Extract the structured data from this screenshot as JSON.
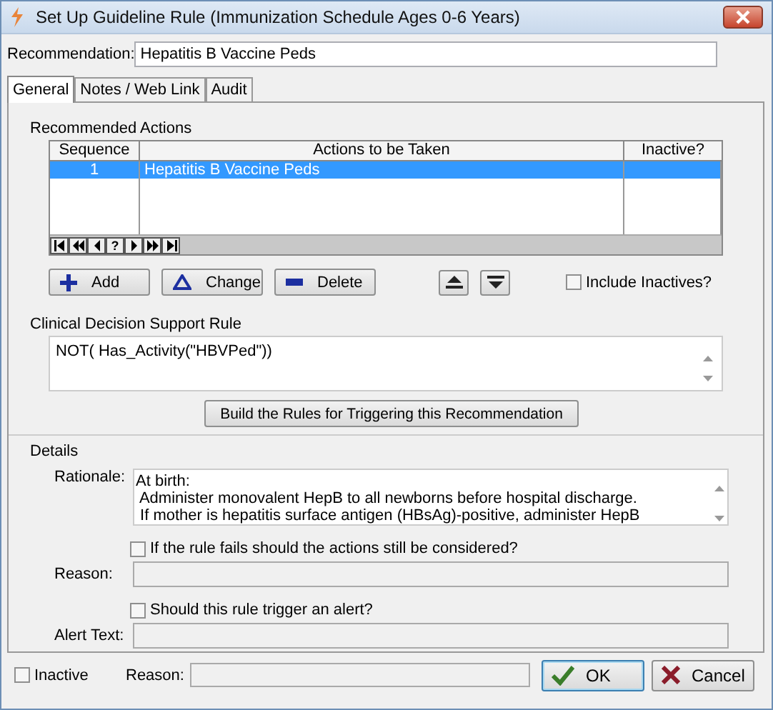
{
  "window": {
    "title": "Set Up Guideline Rule (Immunization Schedule Ages 0-6 Years)"
  },
  "recommendation": {
    "label": "Recommendation:",
    "value": "Hepatitis B Vaccine Peds"
  },
  "tabs": [
    {
      "label": "General",
      "selected": true
    },
    {
      "label": "Notes / Web Link",
      "selected": false
    },
    {
      "label": "Audit",
      "selected": false
    }
  ],
  "recommended_actions": {
    "heading": "Recommended Actions",
    "columns": [
      "Sequence",
      "Actions to be Taken",
      "Inactive?"
    ],
    "rows": [
      {
        "sequence": "1",
        "action": "Hepatitis B Vaccine Peds",
        "selected": true
      }
    ],
    "navigator": [
      {
        "kind": "first"
      },
      {
        "kind": "prev_page"
      },
      {
        "kind": "prev"
      },
      {
        "kind": "help",
        "label": "?"
      },
      {
        "kind": "next"
      },
      {
        "kind": "next_page"
      },
      {
        "kind": "last"
      }
    ],
    "buttons": [
      {
        "kind": "add",
        "label": "Add"
      },
      {
        "kind": "change",
        "label": "Change"
      },
      {
        "kind": "delete",
        "label": "Delete"
      }
    ],
    "move_buttons": [
      {
        "kind": "up"
      },
      {
        "kind": "down"
      }
    ],
    "include_inactives": {
      "label": "Include Inactives?",
      "checked": false
    }
  },
  "rule": {
    "heading": "Clinical Decision Support Rule",
    "value": "NOT( Has_Activity(\"HBVPed\"))",
    "build_button": "Build the Rules for Triggering this Recommendation"
  },
  "details": {
    "heading": "Details",
    "rationale": {
      "label": "Rationale:",
      "lines": [
        "At birth:",
        " Administer monovalent HepB to all newborns before hospital discharge.",
        " If mother is hepatitis surface antigen (HBsAg)-positive, administer HepB"
      ]
    },
    "fails_option": {
      "label": "If the rule fails should the actions still be considered?",
      "checked": false
    },
    "reason": {
      "label": "Reason:"
    },
    "alert_option": {
      "label": "Should this rule trigger an alert?",
      "checked": false
    },
    "alert_text": {
      "label": "Alert Text:"
    }
  },
  "footer": {
    "inactive": {
      "label": "Inactive",
      "checked": false
    },
    "reason": {
      "label": "Reason:"
    },
    "buttons": [
      {
        "kind": "ok",
        "label": "OK"
      },
      {
        "kind": "cancel",
        "label": "Cancel"
      }
    ]
  }
}
